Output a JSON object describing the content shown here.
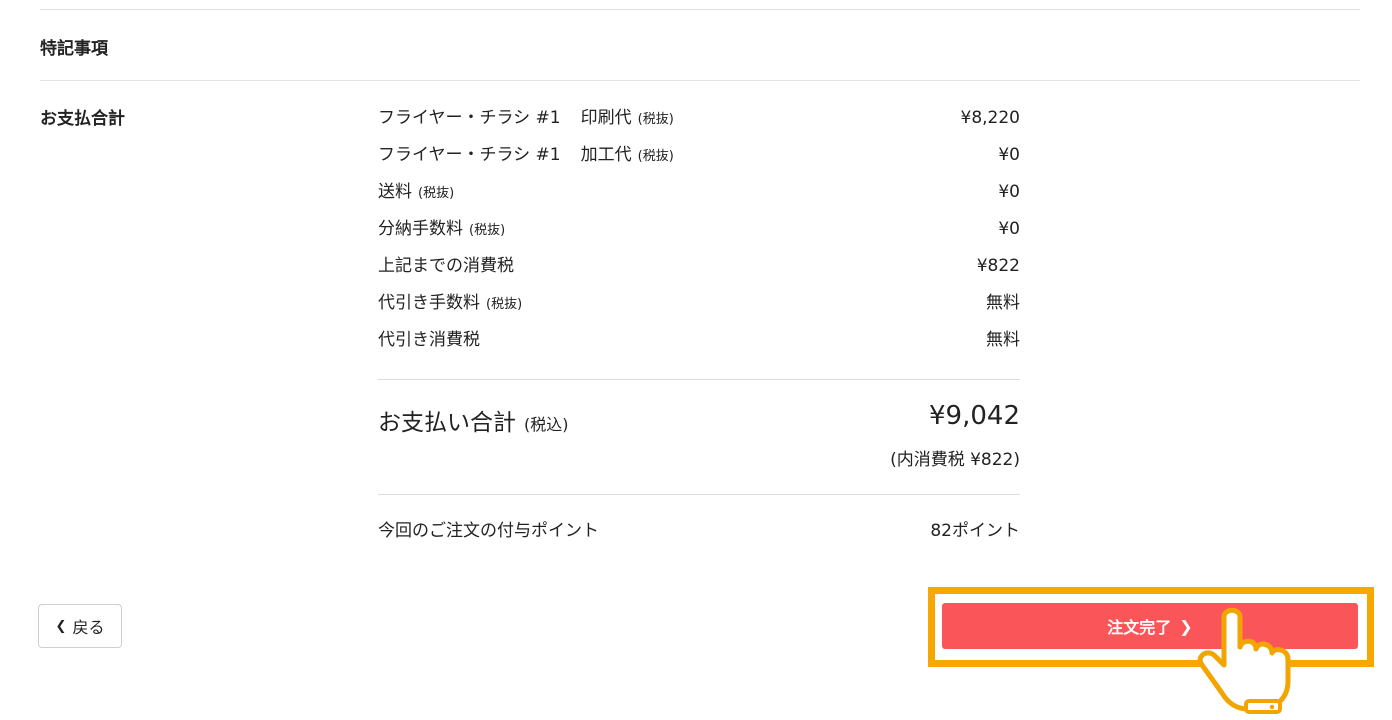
{
  "notes": {
    "label": "特記事項"
  },
  "payment": {
    "label": "お支払合計",
    "rows": [
      {
        "item": "フライヤー・チラシ #1",
        "sub": "印刷代",
        "tax": "(税抜)",
        "value": "¥8,220"
      },
      {
        "item": "フライヤー・チラシ #1",
        "sub": "加工代",
        "tax": "(税抜)",
        "value": "¥0"
      },
      {
        "item": "送料",
        "sub": "",
        "tax": "(税抜)",
        "value": "¥0"
      },
      {
        "item": "分納手数料",
        "sub": "",
        "tax": "(税抜)",
        "value": "¥0"
      },
      {
        "item": "上記までの消費税",
        "sub": "",
        "tax": "",
        "value": "¥822"
      },
      {
        "item": "代引き手数料",
        "sub": "",
        "tax": "(税抜)",
        "value": "無料"
      },
      {
        "item": "代引き消費税",
        "sub": "",
        "tax": "",
        "value": "無料"
      }
    ],
    "total_label": "お支払い合計",
    "total_tax_note": "(税込)",
    "total_value": "¥9,042",
    "included_tax": "(内消費税 ¥822)",
    "points_label": "今回のご注文の付与ポイント",
    "points_value": "82ポイント"
  },
  "actions": {
    "back_label": "戻る",
    "back_icon": "chevron-left-icon",
    "submit_label": "注文完了",
    "submit_icon": "chevron-right-icon",
    "submit_color": "#fa5659",
    "highlight_color": "#f7a800",
    "pointer_icon": "hand-pointer-icon"
  }
}
